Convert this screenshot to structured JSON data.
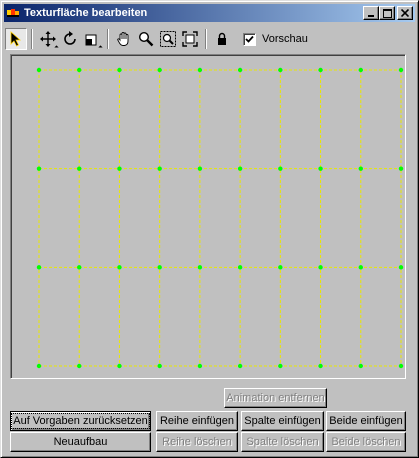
{
  "window": {
    "title": "Texturfläche bearbeiten",
    "controls": {
      "minimize": "_",
      "maximize": "□",
      "close": "×"
    }
  },
  "toolbar": {
    "tools": [
      {
        "name": "select-icon",
        "active": true
      },
      {
        "name": "move-icon",
        "active": false
      },
      {
        "name": "rotate-icon",
        "active": false
      },
      {
        "name": "scale-icon",
        "active": false
      },
      {
        "name": "pan-hand-icon",
        "active": false
      },
      {
        "name": "zoom-icon",
        "active": false
      },
      {
        "name": "zoom-region-icon",
        "active": false
      },
      {
        "name": "zoom-extents-icon",
        "active": false
      },
      {
        "name": "lock-icon",
        "active": false
      }
    ],
    "preview": {
      "label": "Vorschau",
      "checked": true
    }
  },
  "canvas": {
    "background": "#c0c0c0",
    "grid_line_color": "#e8e800",
    "vertex_color": "#00ff00",
    "columns": 9,
    "rows": 3
  },
  "buttons": {
    "remove_animation": "Animation entfernen",
    "reset_defaults": "Auf Vorgaben zurücksetzen",
    "rebuild": "Neuaufbau",
    "insert_row": "Reihe einfügen",
    "insert_column": "Spalte einfügen",
    "insert_both": "Beide einfügen",
    "delete_row": "Reihe löschen",
    "delete_column": "Spalte löschen",
    "delete_both": "Beide löschen"
  }
}
